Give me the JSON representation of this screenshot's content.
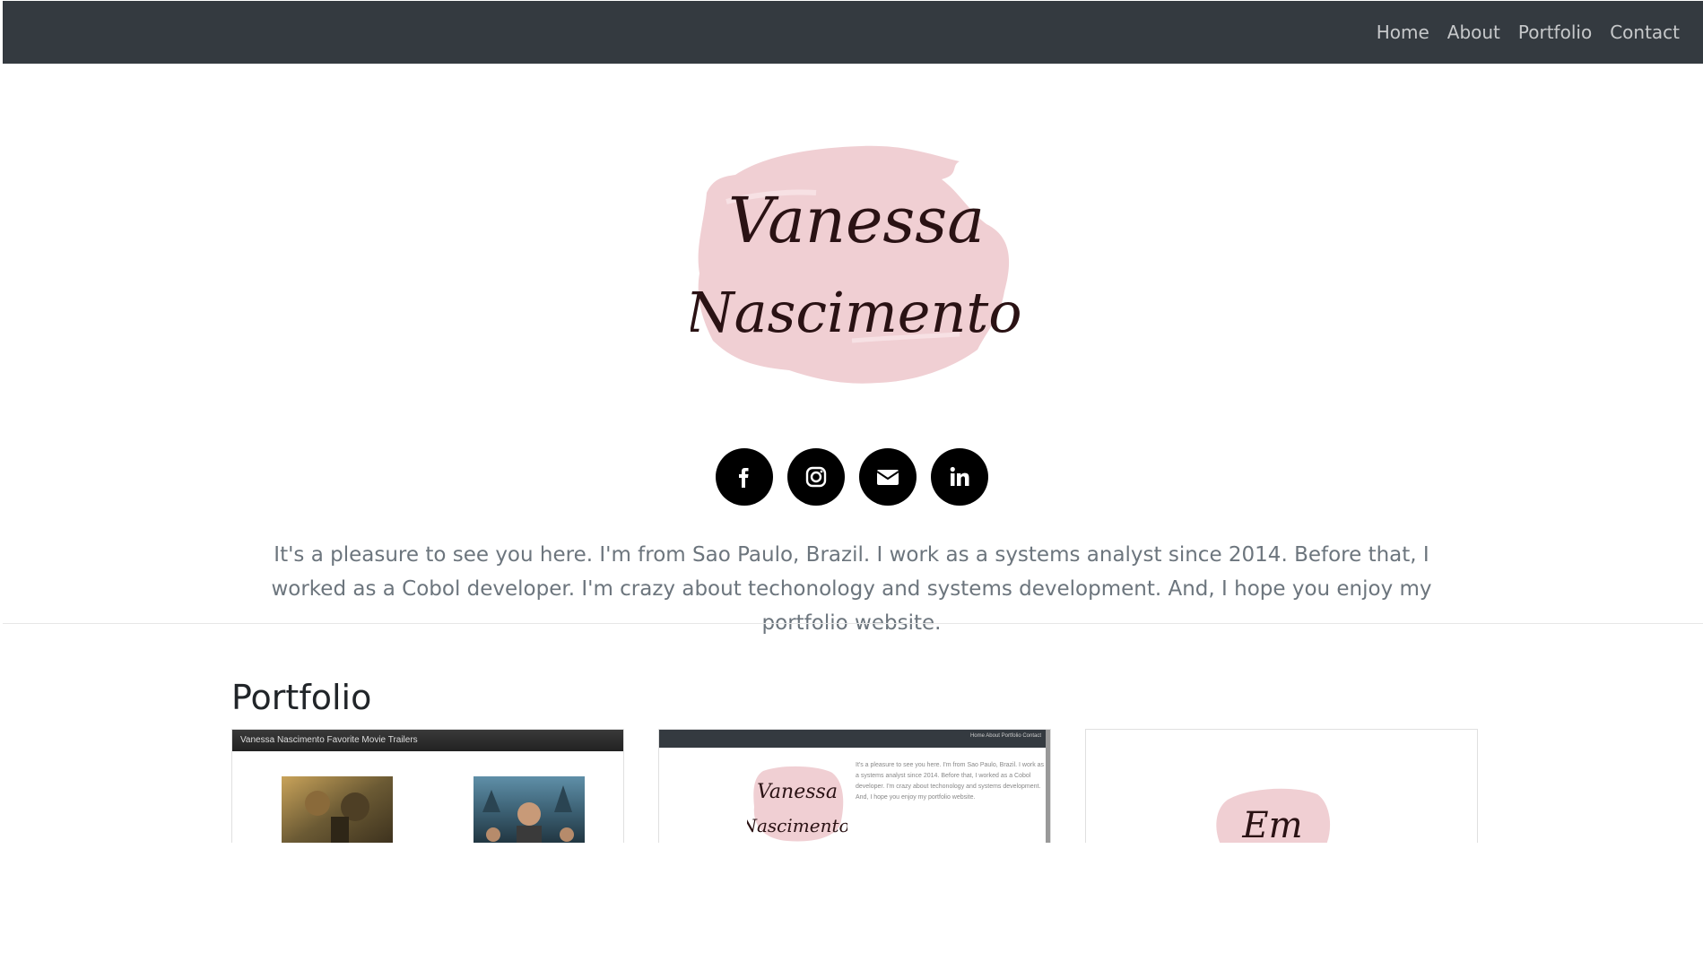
{
  "navbar": {
    "links": [
      "Home",
      "About",
      "Portfolio",
      "Contact"
    ]
  },
  "logo": {
    "line1": "Vanessa",
    "line2": "Nascimento",
    "brush_color": "#f0cfd3",
    "ink_color": "#2a1214"
  },
  "social": [
    {
      "name": "facebook-icon"
    },
    {
      "name": "instagram-icon"
    },
    {
      "name": "email-icon"
    },
    {
      "name": "linkedin-icon"
    }
  ],
  "bio": {
    "text": "It's a pleasure to see you here. I'm from Sao Paulo, Brazil. I work as a systems analyst since 2014. Before that, I worked as a Cobol developer. I'm crazy about techonology and systems development. And, I hope you enjoy my portfolio website."
  },
  "portfolio": {
    "title": "Portfolio",
    "cards": [
      {
        "header": "Vanessa Nascimento Favorite Movie Trailers"
      },
      {
        "nav_links": "Home  About  Portfolio  Contact",
        "bio": "It's a pleasure to see you here. I'm from Sao Paulo, Brazil. I work as a systems analyst since 2014. Before that, I worked as a Cobol developer. I'm crazy about techonology and systems development. And, I hope you enjoy my portfolio website.",
        "logo_line1": "Vanessa",
        "logo_line2": "Nascimento"
      },
      {
        "logo_text": "Em"
      }
    ]
  },
  "colors": {
    "navbar": "#343a40",
    "text_muted": "#6c757d",
    "social_bg": "#000000"
  }
}
